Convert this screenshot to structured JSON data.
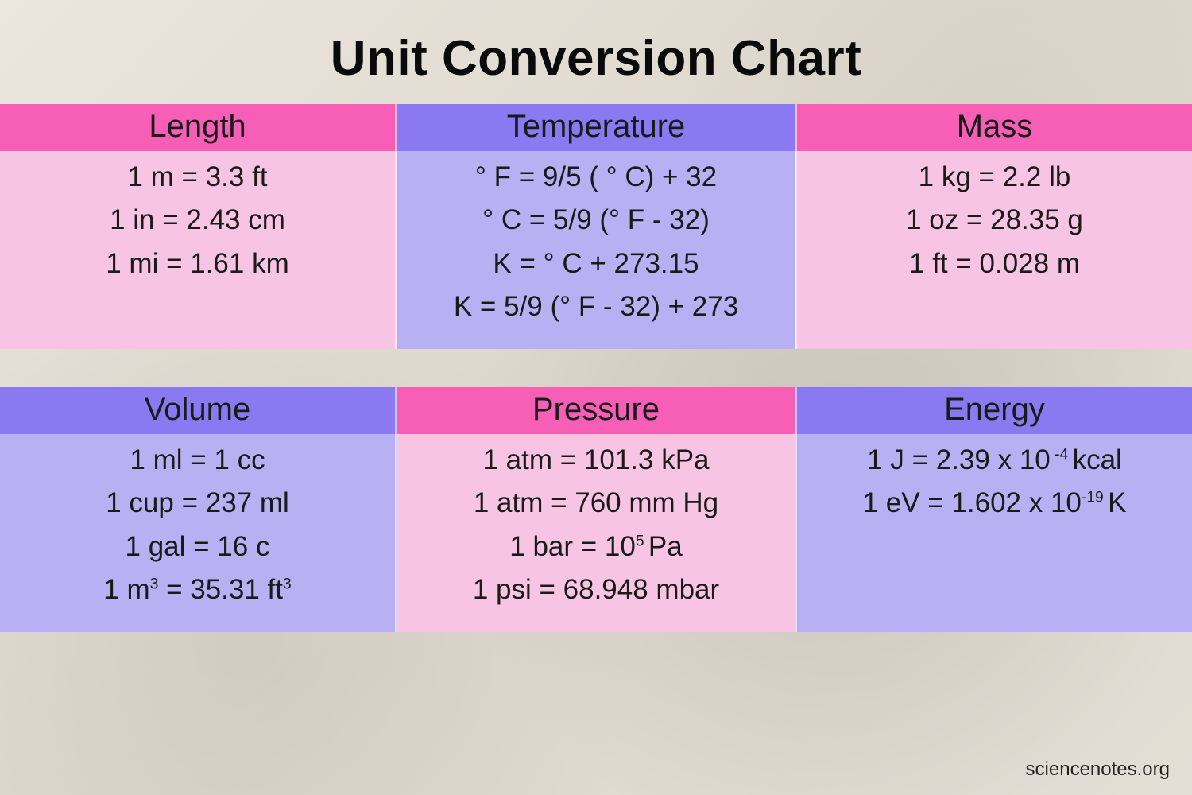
{
  "title": "Unit Conversion Chart",
  "attribution": "sciencenotes.org",
  "sections": {
    "length": {
      "heading": "Length",
      "rows": [
        "1 m = 3.3 ft",
        "1 in = 2.43 cm",
        "1 mi = 1.61 km"
      ]
    },
    "temperature": {
      "heading": "Temperature",
      "rows": [
        "° F = 9/5 ( ° C) + 32",
        "° C = 5/9 (° F - 32)",
        "K = ° C + 273.15",
        "K = 5/9 (° F - 32) + 273"
      ]
    },
    "mass": {
      "heading": "Mass",
      "rows": [
        "1  kg = 2.2 lb",
        "1 oz = 28.35 g",
        "1 ft  = 0.028 m"
      ]
    },
    "volume": {
      "heading": "Volume",
      "rows": [
        "1  ml = 1 cc",
        "1 cup = 237 ml",
        "1 gal = 16 c"
      ],
      "row4_html": "1 m<sup>3</sup>  = 35.31 ft<sup>3</sup>",
      "row4_plain": "1 m^3 = 35.31 ft^3"
    },
    "pressure": {
      "heading": "Pressure",
      "rows": [
        "1 atm = 101.3 kPa",
        "1 atm = 760 mm Hg"
      ],
      "row3_html": "1 bar = 10<sup>5 </sup>Pa",
      "row3_plain": "1 bar = 10^5 Pa",
      "row4": "1 psi = 68.948 mbar"
    },
    "energy": {
      "heading": "Energy",
      "row1_html": "1 J = 2.39 x 10<sup> -4 </sup>kcal",
      "row1_plain": "1 J = 2.39 x 10^-4 kcal",
      "row2_html": "1 eV = 1.602 x 10<sup>-19 </sup>K",
      "row2_plain": "1 eV = 1.602 x 10^-19 K"
    }
  },
  "chart_data": {
    "type": "table",
    "title": "Unit Conversion Chart",
    "categories": [
      "Length",
      "Temperature",
      "Mass",
      "Volume",
      "Pressure",
      "Energy"
    ],
    "conversions": {
      "Length": [
        "1 m = 3.3 ft",
        "1 in = 2.43 cm",
        "1 mi = 1.61 km"
      ],
      "Temperature": [
        "°F = 9/5 (°C) + 32",
        "°C = 5/9 (°F - 32)",
        "K = °C + 273.15",
        "K = 5/9 (°F - 32) + 273"
      ],
      "Mass": [
        "1 kg = 2.2 lb",
        "1 oz = 28.35 g",
        "1 ft = 0.028 m"
      ],
      "Volume": [
        "1 ml = 1 cc",
        "1 cup = 237 ml",
        "1 gal = 16 c",
        "1 m^3 = 35.31 ft^3"
      ],
      "Pressure": [
        "1 atm = 101.3 kPa",
        "1 atm = 760 mm Hg",
        "1 bar = 10^5 Pa",
        "1 psi = 68.948 mbar"
      ],
      "Energy": [
        "1 J = 2.39 x 10^-4 kcal",
        "1 eV = 1.602 x 10^-19 K"
      ]
    }
  }
}
